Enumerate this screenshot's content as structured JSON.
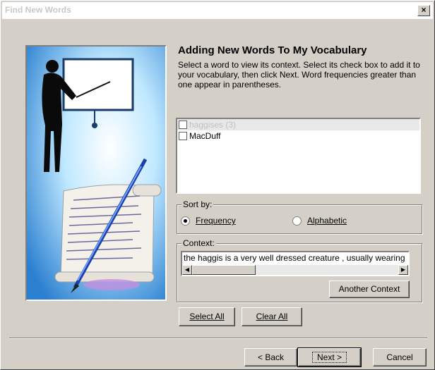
{
  "window": {
    "title": "Find New Words",
    "close_label": "×"
  },
  "header": {
    "title": "Adding New Words To My Vocabulary",
    "description": "Select a word to view its context. Select its check box to add it to your vocabulary, then click Next. Word frequencies greater than one appear in parentheses."
  },
  "words": [
    {
      "label": "haggises (3)",
      "checked": false,
      "selected": true
    },
    {
      "label": "MacDuff",
      "checked": false,
      "selected": false
    }
  ],
  "sort": {
    "legend": "Sort by:",
    "options": [
      {
        "label": "Frequency",
        "selected": true
      },
      {
        "label": "Alphabetic",
        "selected": false
      }
    ]
  },
  "context": {
    "legend": "Context:",
    "text": "the haggis is a very well dressed creature , usually wearing",
    "another_label": "Another Context"
  },
  "buttons": {
    "select_all": "Select All",
    "clear_all": "Clear All",
    "back": "< Back",
    "next": "Next >",
    "cancel": "Cancel"
  }
}
